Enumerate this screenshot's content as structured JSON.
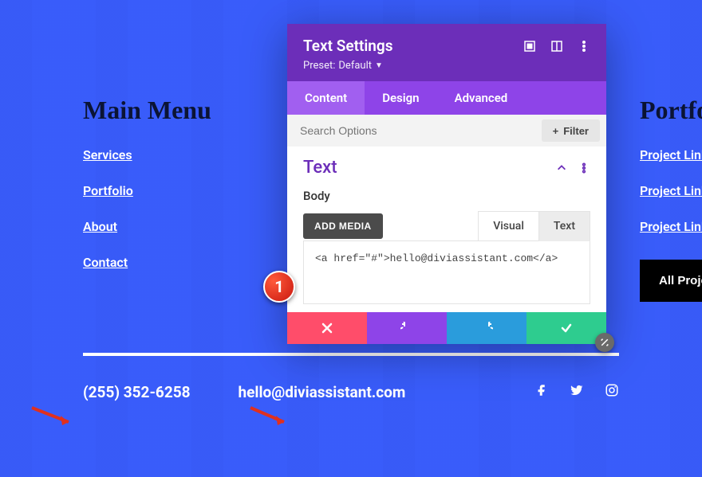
{
  "mainMenu": {
    "title": "Main Menu",
    "items": [
      "Services",
      "Portfolio",
      "About",
      "Contact"
    ]
  },
  "portfolio": {
    "title": "Portfolio",
    "items": [
      "Project Link",
      "Project Link",
      "Project Link"
    ],
    "button": "All Projects"
  },
  "footer": {
    "phone": "(255) 352-6258",
    "email": "hello@diviassistant.com"
  },
  "panel": {
    "title": "Text Settings",
    "presetLabel": "Preset:",
    "presetValue": "Default",
    "tabs": {
      "content": "Content",
      "design": "Design",
      "advanced": "Advanced"
    },
    "searchPlaceholder": "Search Options",
    "filterLabel": "Filter",
    "section": {
      "title": "Text",
      "bodyLabel": "Body",
      "addMedia": "ADD MEDIA",
      "visualTab": "Visual",
      "textTab": "Text",
      "code": "<a href=\"#\">hello@diviassistant.com</a>"
    },
    "stepNumber": "1"
  }
}
